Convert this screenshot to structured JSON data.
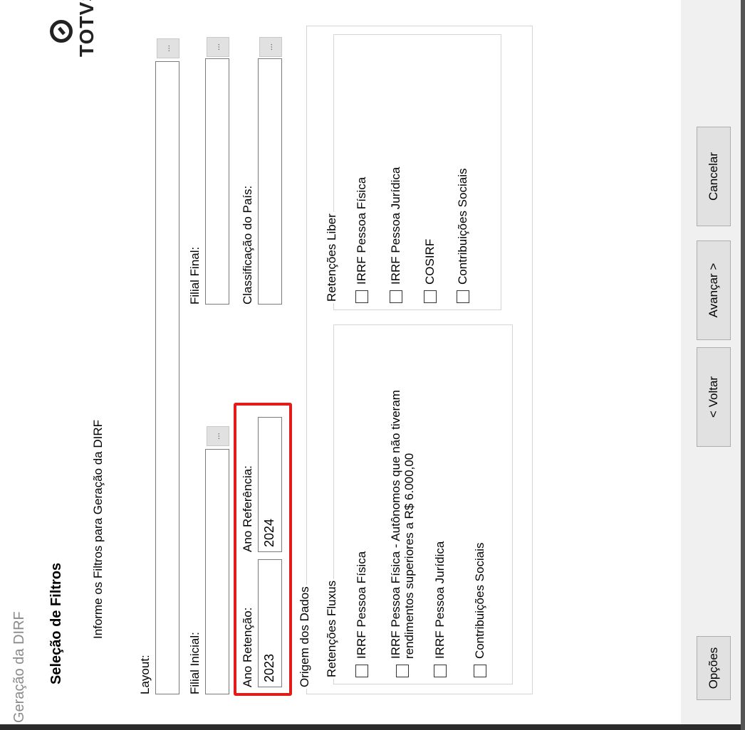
{
  "window": {
    "title": "Geração da DIRF"
  },
  "header": {
    "heading": "Seleção de Filtros",
    "subheading": "Informe os Filtros para Geração da DIRF",
    "logo_text": "TOTVS"
  },
  "filters": {
    "layout": {
      "label": "Layout:",
      "value": ""
    },
    "filial_inicial": {
      "label": "Filial Inicial:",
      "value": ""
    },
    "filial_final": {
      "label": "Filial Final:",
      "value": ""
    },
    "ano_retencao": {
      "label": "Ano Retenção:",
      "value": "2023"
    },
    "ano_referencia": {
      "label": "Ano Referência:",
      "value": "2024"
    },
    "classificacao_pais": {
      "label": "Classificação do País:",
      "value": ""
    },
    "lookup_label": "..."
  },
  "origem": {
    "title": "Origem dos Dados",
    "fluxus": {
      "title": "Retenções Fluxus",
      "items": [
        {
          "label": "IRRF Pessoa Física"
        },
        {
          "label": "IRRF Pessoa Física - Autônomos que não tiveram",
          "label2": "rendimentos superiores a R$ 6.000,00"
        },
        {
          "label": "IRRF Pessoa Jurídica"
        },
        {
          "label": "Contribuições Sociais"
        }
      ]
    },
    "liber": {
      "title": "Retenções Liber",
      "items": [
        {
          "label": "IRRF Pessoa Física"
        },
        {
          "label": "IRRF Pessoa Jurídica"
        },
        {
          "label": "COSIRF"
        },
        {
          "label": "Contribuições Sociais"
        }
      ]
    }
  },
  "buttons": {
    "options": "Opções",
    "back": "< Voltar",
    "next": "Avançar >",
    "cancel": "Cancelar"
  }
}
